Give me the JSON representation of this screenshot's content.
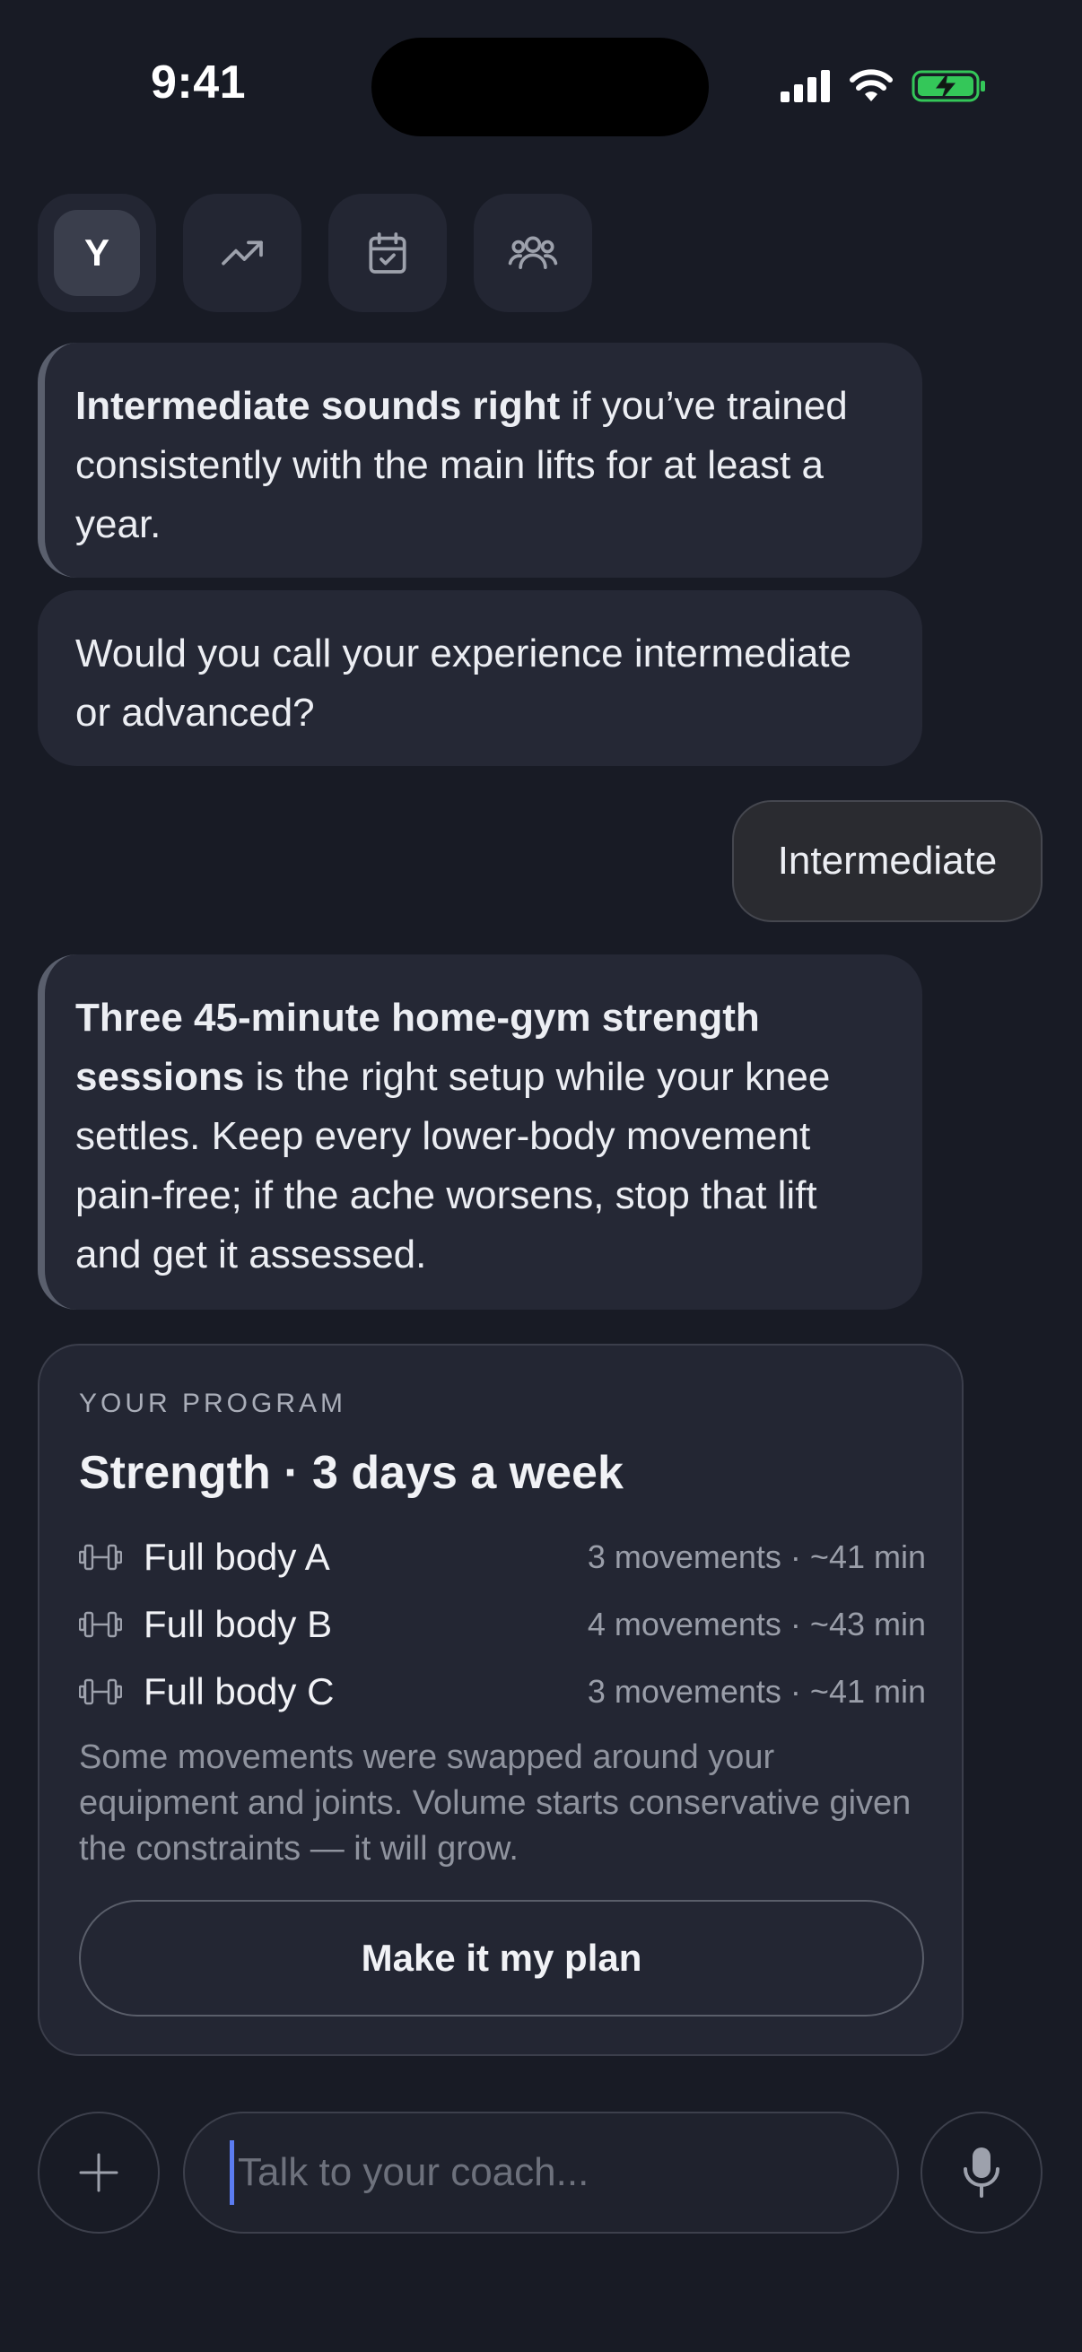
{
  "status_bar": {
    "time": "9:41",
    "icons": [
      "signal-icon",
      "wifi-icon",
      "battery-charging-icon"
    ]
  },
  "nav": {
    "avatar_letter": "Y",
    "icons": [
      "trending-up-icon",
      "calendar-check-icon",
      "users-icon"
    ]
  },
  "messages": {
    "m1_bold": "Intermediate sounds right",
    "m1_text": " if you’ve trained consistently with the main lifts for at least a year.",
    "m2_text": "Would you call your experience intermediate or advanced?",
    "user_reply": "Intermediate",
    "m3_bold": "Three 45-minute home-gym strength sessions",
    "m3_text": " is the right setup while your knee settles. Keep every lower-body movement pain-free; if the ache worsens, stop that lift and get it assessed."
  },
  "program": {
    "eyebrow": "YOUR PROGRAM",
    "title": "Strength · 3 days a week",
    "workouts": [
      {
        "name": "Full body A",
        "meta": "3 movements · ~41 min"
      },
      {
        "name": "Full body B",
        "meta": "4 movements · ~43 min"
      },
      {
        "name": "Full body C",
        "meta": "3 movements · ~41 min"
      }
    ],
    "note": "Some movements were swapped around your equipment and joints. Volume starts conservative given the constraints — it will grow.",
    "button_label": "Make it my plan"
  },
  "composer": {
    "placeholder": "Talk to your coach...",
    "value": ""
  },
  "colors": {
    "background": "#181b25",
    "bubble": "#252835",
    "caret": "#5b7cf0",
    "battery": "#34c759"
  }
}
